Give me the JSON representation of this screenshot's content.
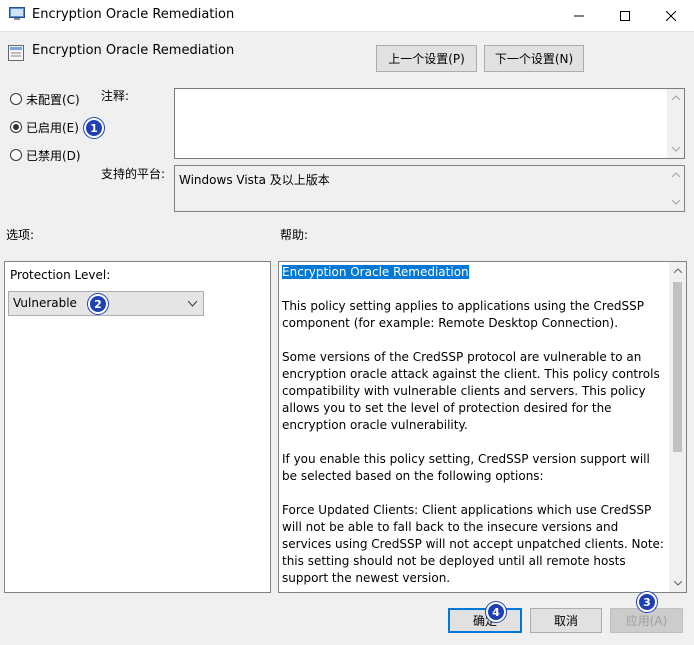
{
  "window": {
    "title": "Encryption Oracle Remediation",
    "icon": "policy-icon"
  },
  "header": {
    "title": "Encryption Oracle Remediation",
    "prev_label": "上一个设置(P)",
    "next_label": "下一个设置(N)"
  },
  "state": {
    "options": [
      {
        "label": "未配置(C)",
        "selected": false
      },
      {
        "label": "已启用(E)",
        "selected": true
      },
      {
        "label": "已禁用(D)",
        "selected": false
      }
    ]
  },
  "comment": {
    "label": "注释:",
    "value": ""
  },
  "platform": {
    "label": "支持的平台:",
    "value": "Windows Vista 及以上版本"
  },
  "options_panel": {
    "label": "选项:",
    "field_label": "Protection Level:",
    "selected": "Vulnerable"
  },
  "help_panel": {
    "label": "帮助:",
    "heading": "Encryption Oracle Remediation",
    "paragraphs": [
      "This policy setting applies to applications using the CredSSP component (for example: Remote Desktop Connection).",
      "Some versions of the CredSSP protocol are vulnerable to an encryption oracle attack against the client.  This policy controls compatibility with vulnerable clients and servers.  This policy allows you to set the level of protection desired for the encryption oracle vulnerability.",
      "If you enable this policy setting, CredSSP version support will be selected based on the following options:",
      "Force Updated Clients: Client applications which use CredSSP will not be able to fall back to the insecure versions and services using CredSSP will not accept unpatched clients. Note: this setting should not be deployed until all remote hosts support the newest version."
    ]
  },
  "footer": {
    "ok_label": "确定",
    "cancel_label": "取消",
    "apply_label": "应用(A)"
  },
  "badges": [
    "1",
    "2",
    "3",
    "4"
  ]
}
